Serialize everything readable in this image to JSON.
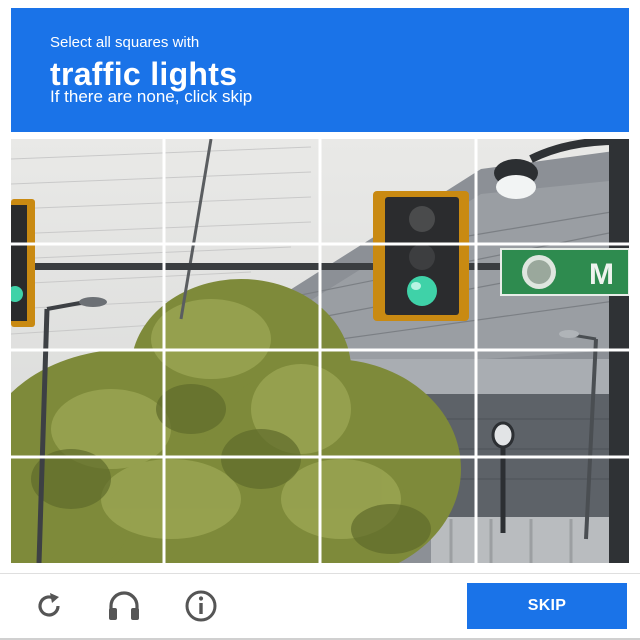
{
  "challenge": {
    "instruction": "Select all squares with",
    "target": "traffic lights",
    "hint": "If there are none, click skip"
  },
  "grid": {
    "rows": 4,
    "cols": 4
  },
  "street_sign": {
    "text": "M"
  },
  "footer": {
    "reload_icon": "reload-icon",
    "audio_icon": "headphones-icon",
    "info_icon": "info-icon",
    "skip_label": "SKIP"
  },
  "colors": {
    "accent": "#1a73e8",
    "sign_green": "#2e8b4f",
    "signal_housing": "#c98a12",
    "signal_green_lamp": "#3fd2a8"
  }
}
